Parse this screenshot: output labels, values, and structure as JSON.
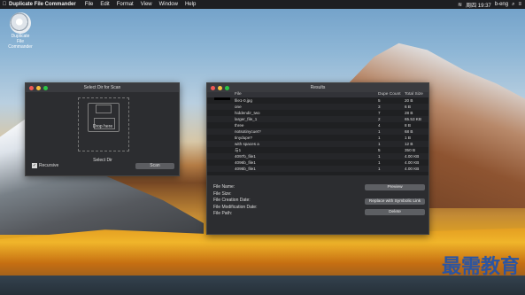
{
  "menubar": {
    "app_name": "Duplicate File Commander",
    "menus": [
      "File",
      "Edit",
      "Format",
      "View",
      "Window",
      "Help"
    ],
    "time": "周四 19:37",
    "user": "b-eng"
  },
  "desktop_icon_label": "Duplicate File Commander",
  "scan_window": {
    "title": "Select Dir for Scan",
    "drop_text": "Drop here",
    "select_dir": "Select Dir",
    "recursive_label": "Recursive",
    "scan_button": "Scan"
  },
  "results_window": {
    "title": "Results",
    "columns": [
      "File",
      "Dupe Count",
      "Total Size"
    ],
    "rows": [
      {
        "file": "file1-0.jpg",
        "count": "5",
        "size": "20 B"
      },
      {
        "file": "one",
        "count": "3",
        "size": "6 B"
      },
      {
        "file": "hiddendir_two",
        "count": "7",
        "size": "28 B"
      },
      {
        "file": "larger_file_1",
        "count": "2",
        "size": "65.53 KB"
      },
      {
        "file": "three",
        "count": "4",
        "size": "8 B"
      },
      {
        "file": "notsotinycuet?",
        "count": "1",
        "size": "68 B"
      },
      {
        "file": "tinydupe?",
        "count": "1",
        "size": "1 B"
      },
      {
        "file": "with spaces a",
        "count": "1",
        "size": "12 B"
      },
      {
        "file": "与1",
        "count": "5",
        "size": "350 B"
      },
      {
        "file": "4097b_file1",
        "count": "1",
        "size": "4.00 KB"
      },
      {
        "file": "4096b_file1",
        "count": "1",
        "size": "4.00 KB"
      },
      {
        "file": "4095b_file1",
        "count": "1",
        "size": "4.00 KB"
      }
    ],
    "details": [
      "File Name:",
      "File Size:",
      "File Creation Date:",
      "File Modification Date:",
      "File Path:"
    ],
    "buttons": [
      "Preview",
      "Replace with Symbolic Link",
      "Delete"
    ]
  },
  "watermark": "最需教育"
}
